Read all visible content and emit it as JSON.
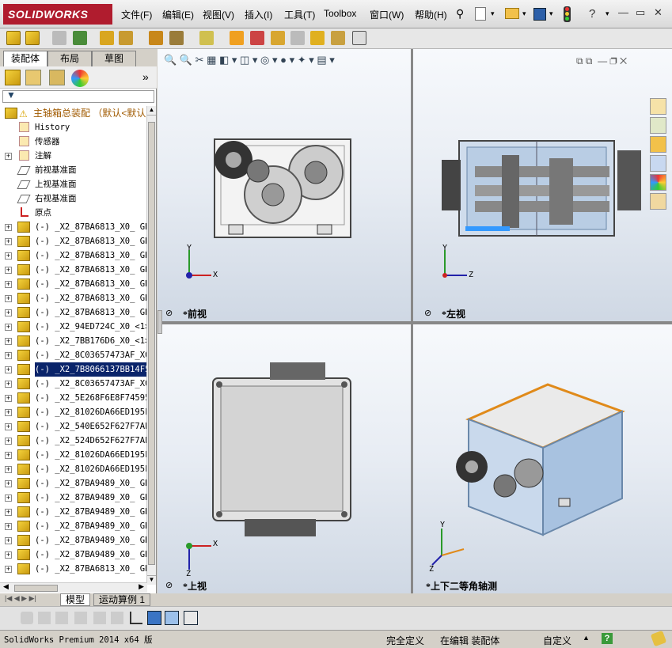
{
  "title_bar": {
    "logo": "SOLIDWORKS",
    "menus": [
      "文件(F)",
      "编辑(E)",
      "视图(V)",
      "插入(I)",
      "工具(T)",
      "Toolbox",
      "窗口(W)",
      "帮助(H)"
    ],
    "help_glyph": "?"
  },
  "feature_manager": {
    "tabs": [
      "装配体",
      "布局",
      "草图"
    ],
    "top_item": "主轴箱总装配 （默认<默认",
    "items": [
      {
        "label": "History",
        "icon": "history-icon",
        "expand": false
      },
      {
        "label": "传感器",
        "icon": "sensor-icon",
        "expand": false
      },
      {
        "label": "注解",
        "icon": "annotation-icon",
        "expand": true
      },
      {
        "label": "前视基准面",
        "icon": "plane-icon",
        "expand": false
      },
      {
        "label": "上视基准面",
        "icon": "plane-icon",
        "expand": false
      },
      {
        "label": "右视基准面",
        "icon": "plane-icon",
        "expand": false
      },
      {
        "label": "原点",
        "icon": "origin-icon",
        "expand": false
      },
      {
        "label": "(-) _X2_87BA6813_X0_ GB",
        "icon": "part-icon",
        "expand": true
      },
      {
        "label": "(-) _X2_87BA6813_X0_ GB",
        "icon": "part-icon",
        "expand": true
      },
      {
        "label": "(-) _X2_87BA6813_X0_ GB",
        "icon": "part-icon",
        "expand": true
      },
      {
        "label": "(-) _X2_87BA6813_X0_ GB",
        "icon": "part-icon",
        "expand": true
      },
      {
        "label": "(-) _X2_87BA6813_X0_ GB",
        "icon": "part-icon",
        "expand": true
      },
      {
        "label": "(-) _X2_87BA6813_X0_ GB",
        "icon": "part-icon",
        "expand": true
      },
      {
        "label": "(-) _X2_87BA6813_X0_ GB",
        "icon": "part-icon",
        "expand": true
      },
      {
        "label": "(-) _X2_94ED724C_X0_<1>",
        "icon": "part-icon",
        "expand": true
      },
      {
        "label": "(-) _X2_7BB176D6_X0_<1>",
        "icon": "part-icon",
        "expand": true
      },
      {
        "label": "(-) _X2_8C03657473AF_X0",
        "icon": "part-icon",
        "expand": true
      },
      {
        "label": "(-) _X2_7B8066137BB14F5",
        "icon": "part-icon",
        "expand": true,
        "selected": true
      },
      {
        "label": "(-) _X2_8C03657473AF_X0",
        "icon": "part-icon",
        "expand": true
      },
      {
        "label": "(-) _X2_5E268F6E8F74595",
        "icon": "part-icon",
        "expand": true
      },
      {
        "label": "(-) _X2_81026DA66ED195F",
        "icon": "part-icon",
        "expand": true
      },
      {
        "label": "(-) _X2_540E652F627F7AE",
        "icon": "part-icon",
        "expand": true
      },
      {
        "label": "(-) _X2_524D652F627F7AE",
        "icon": "part-icon",
        "expand": true
      },
      {
        "label": "(-) _X2_81026DA66ED195F",
        "icon": "part-icon",
        "expand": true
      },
      {
        "label": "(-) _X2_81026DA66ED195F",
        "icon": "part-icon",
        "expand": true
      },
      {
        "label": "(-) _X2_87BA9489_X0_ GB",
        "icon": "part-icon",
        "expand": true
      },
      {
        "label": "(-) _X2_87BA9489_X0_ GB",
        "icon": "part-icon",
        "expand": true
      },
      {
        "label": "(-) _X2_87BA9489_X0_ GB",
        "icon": "part-icon",
        "expand": true
      },
      {
        "label": "(-) _X2_87BA9489_X0_ GB",
        "icon": "part-icon",
        "expand": true
      },
      {
        "label": "(-) _X2_87BA9489_X0_ GB",
        "icon": "part-icon",
        "expand": true
      },
      {
        "label": "(-) _X2_87BA9489_X0_ GB",
        "icon": "part-icon",
        "expand": true
      },
      {
        "label": "(-) _X2_87BA6813_X0_ GB",
        "icon": "part-icon",
        "expand": true
      }
    ]
  },
  "viewports": {
    "front": "*前视",
    "left": "*左视",
    "top": "*上视",
    "iso": "*上下二等角轴测"
  },
  "axes": {
    "x": "X",
    "y": "Y",
    "z": "Z"
  },
  "bottom_tabs": [
    "模型",
    "运动算例 1"
  ],
  "status_bar": {
    "version": "SolidWorks Premium 2014 x64 版",
    "fully_defined": "完全定义",
    "editing": "在编辑 装配体",
    "custom": "自定义",
    "help": "?"
  },
  "colors": {
    "accent": "#b01c2e",
    "selection": "#0a246a",
    "highlight_orange": "#e08a1a",
    "part_blue": "#9db8d6"
  }
}
